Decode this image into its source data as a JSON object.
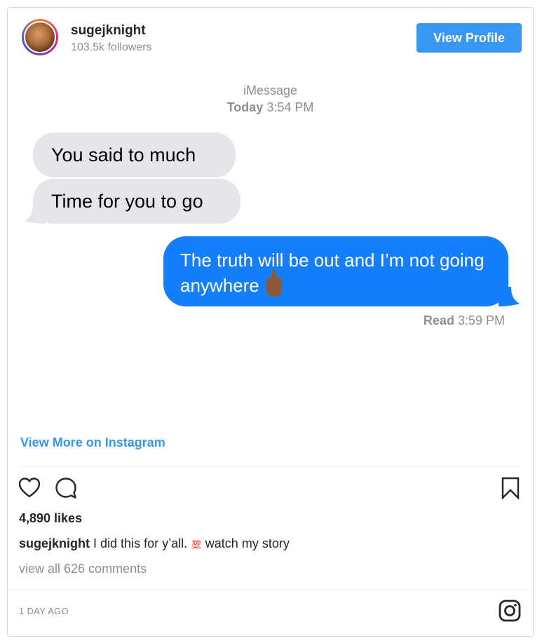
{
  "header": {
    "username": "sugejknight",
    "followers": "103.5k followers",
    "view_profile_label": "View Profile"
  },
  "chat": {
    "service_label": "iMessage",
    "timestamp_prefix": "Today",
    "timestamp_time": "3:54 PM",
    "incoming": [
      "You said to much",
      "Time for you to go"
    ],
    "outgoing": "The truth will be out and I’m not going anywhere",
    "read_prefix": "Read",
    "read_time": "3:59 PM"
  },
  "view_more_label": "View More on Instagram",
  "engagement": {
    "likes": "4,890 likes",
    "caption_user": "sugejknight",
    "caption_text_1": "I did this for y’all.",
    "caption_emoji": "💯",
    "caption_text_2": "watch my story",
    "view_comments": "view all 626 comments",
    "posted": "1 DAY AGO"
  },
  "icons": [
    "heart-icon",
    "comment-icon",
    "bookmark-icon",
    "instagram-icon",
    "middle-finger-emoji",
    "hundred-emoji"
  ],
  "colors": {
    "accent": "#3897f0",
    "imessage_blue": "#147efb",
    "incoming_bubble": "#e5e5ea",
    "secondary_text": "#8e8e8e"
  }
}
